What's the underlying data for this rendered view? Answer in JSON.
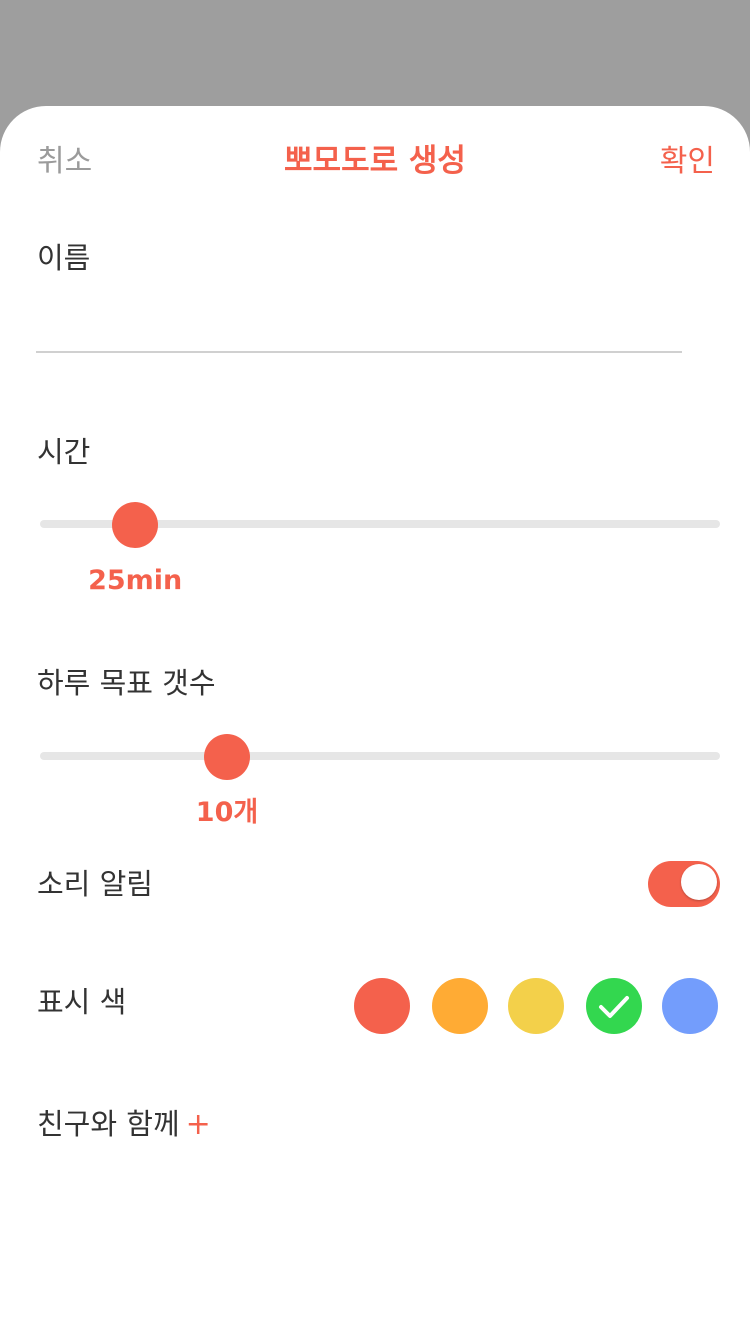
{
  "header": {
    "cancel_label": "취소",
    "title": "뽀모도로 생성",
    "confirm_label": "확인"
  },
  "name_field": {
    "label": "이름",
    "value": ""
  },
  "time_slider": {
    "label": "시간",
    "value_label": "25min",
    "level": 0.14
  },
  "goal_slider": {
    "label": "하루 목표 갯수",
    "value_label": "10개",
    "level": 0.275
  },
  "sound_alarm": {
    "label": "소리 알림",
    "on": true
  },
  "display_color": {
    "label": "표시 색",
    "swatches": [
      {
        "name": "red",
        "color": "#f4614c",
        "selected": false
      },
      {
        "name": "orange",
        "color": "#ffab34",
        "selected": false
      },
      {
        "name": "yellow",
        "color": "#f3d04a",
        "selected": false
      },
      {
        "name": "green",
        "color": "#33d74f",
        "selected": true
      },
      {
        "name": "blue",
        "color": "#739dfc",
        "selected": false
      }
    ]
  },
  "friends": {
    "label": "친구와 함께",
    "add_symbol": "+"
  }
}
